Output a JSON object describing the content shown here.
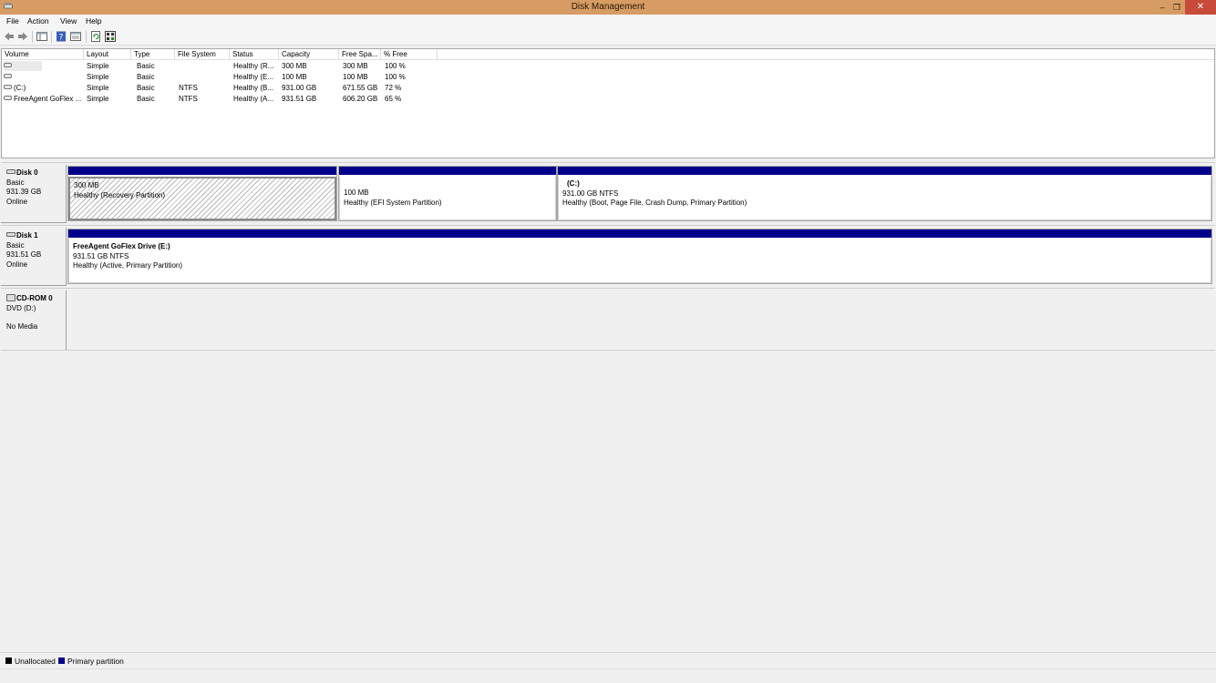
{
  "window": {
    "title": "Disk Management"
  },
  "menu": [
    "File",
    "Action",
    "View",
    "Help"
  ],
  "colors": {
    "titlebar": "#d69c63",
    "primary": "#00008b",
    "unallocated": "#000000"
  },
  "volume_list": {
    "columns": [
      "Volume",
      "Layout",
      "Type",
      "File System",
      "Status",
      "Capacity",
      "Free Spa...",
      "% Free"
    ],
    "rows": [
      {
        "volume": "",
        "layout": "Simple",
        "type": "Basic",
        "fs": "",
        "status": "Healthy (R...",
        "capacity": "300 MB",
        "free": "300 MB",
        "pct": "100 %"
      },
      {
        "volume": "",
        "layout": "Simple",
        "type": "Basic",
        "fs": "",
        "status": "Healthy (E...",
        "capacity": "100 MB",
        "free": "100 MB",
        "pct": "100 %"
      },
      {
        "volume": "(C:)",
        "layout": "Simple",
        "type": "Basic",
        "fs": "NTFS",
        "status": "Healthy (B...",
        "capacity": "931.00 GB",
        "free": "671.55 GB",
        "pct": "72 %"
      },
      {
        "volume": "FreeAgent GoFlex ...",
        "layout": "Simple",
        "type": "Basic",
        "fs": "NTFS",
        "status": "Healthy (A...",
        "capacity": "931.51 GB",
        "free": "606.20 GB",
        "pct": "65 %"
      }
    ]
  },
  "disks": [
    {
      "name": "Disk 0",
      "type": "Basic",
      "size": "931.39 GB",
      "state": "Online",
      "partitions": [
        {
          "title": "",
          "size": "300 MB",
          "status": "Healthy (Recovery Partition)"
        },
        {
          "title": "",
          "size": "100 MB",
          "status": "Healthy (EFI System Partition)"
        },
        {
          "title": "(C:)",
          "size": "931.00 GB NTFS",
          "status": "Healthy (Boot, Page File, Crash Dump, Primary Partition)"
        }
      ]
    },
    {
      "name": "Disk 1",
      "type": "Basic",
      "size": "931.51 GB",
      "state": "Online",
      "partitions": [
        {
          "title": "FreeAgent GoFlex Drive  (E:)",
          "size": "931.51 GB NTFS",
          "status": "Healthy (Active, Primary Partition)"
        }
      ]
    },
    {
      "name": "CD-ROM 0",
      "type": "DVD (D:)",
      "state": "No Media"
    }
  ],
  "legend": [
    "Unallocated",
    "Primary partition"
  ]
}
